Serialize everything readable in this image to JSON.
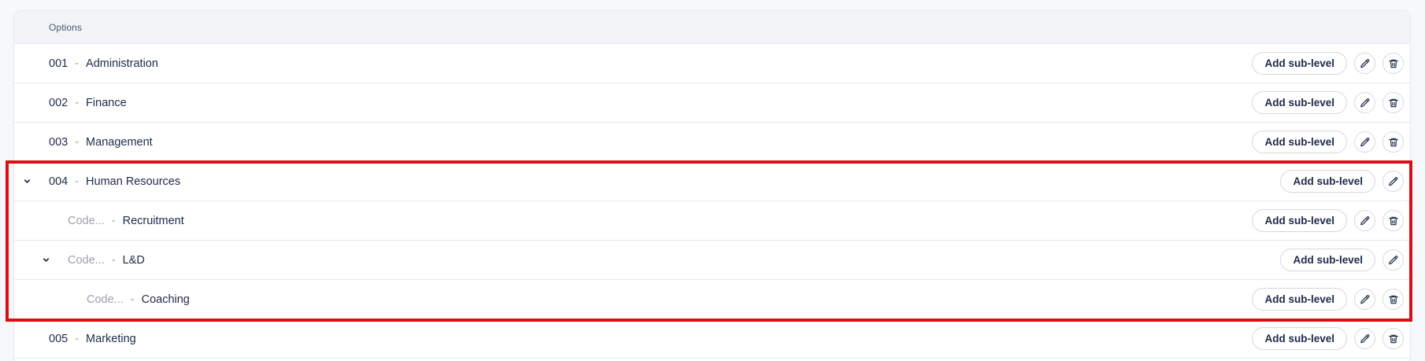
{
  "header": {
    "title": "Options"
  },
  "labels": {
    "add_sublevel": "Add sub-level",
    "separator": "-"
  },
  "colors": {
    "highlight": "#d90f16",
    "text": "#1e2a4a",
    "muted": "#9aa1b3"
  },
  "icons": {
    "edit": "pencil-icon",
    "delete": "trash-icon",
    "expand": "chevron-down-icon"
  },
  "rows": [
    {
      "code": "001",
      "name": "Administration",
      "level": 0,
      "expanded": false,
      "deletable": true
    },
    {
      "code": "002",
      "name": "Finance",
      "level": 0,
      "expanded": false,
      "deletable": true
    },
    {
      "code": "003",
      "name": "Management",
      "level": 0,
      "expanded": false,
      "deletable": true
    },
    {
      "code": "004",
      "name": "Human Resources",
      "level": 0,
      "expanded": true,
      "deletable": false
    },
    {
      "code": "Code...",
      "name": "Recruitment",
      "level": 1,
      "expanded": false,
      "deletable": true
    },
    {
      "code": "Code...",
      "name": "L&D",
      "level": 1,
      "expanded": true,
      "deletable": false
    },
    {
      "code": "Code...",
      "name": "Coaching",
      "level": 2,
      "expanded": false,
      "deletable": true
    },
    {
      "code": "005",
      "name": "Marketing",
      "level": 0,
      "expanded": false,
      "deletable": true
    }
  ]
}
